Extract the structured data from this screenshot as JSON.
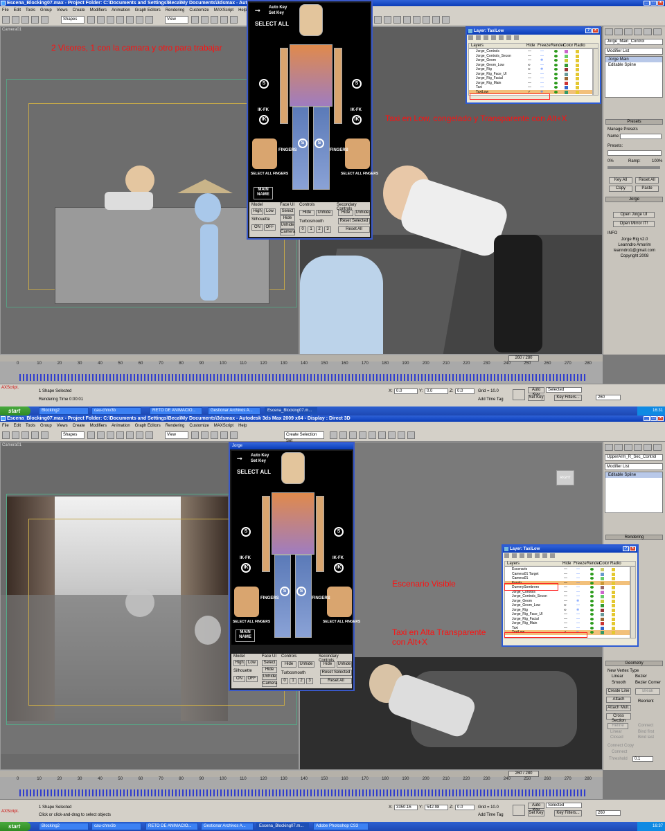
{
  "menu": [
    "File",
    "Edit",
    "Tools",
    "Group",
    "Views",
    "Create",
    "Modifiers",
    "Animation",
    "Graph Editors",
    "Rendering",
    "Customize",
    "MAXScript",
    "Help"
  ],
  "top": {
    "title": "Escena_Blocking07.max   - Project Folder: C:\\Documents and Settings\\Beca\\My Documents\\3dsmax   - Autod",
    "shapes_select": "Shapes",
    "view_select": "View",
    "viewport_label": "Camera01",
    "annotation_1": "2 Visores, 1 con la camara y otro para trabajar",
    "annotation_2": "Taxi en Low, congelado y Transparente con Alt+X",
    "cmd": {
      "object_name": "Jorge_Main_Control",
      "modifier_list": "Modifier List",
      "stack": [
        "Jorge Main",
        "Editable Spline"
      ],
      "presets_rollout": "Presets",
      "manage_presets": "Manage Presets",
      "name_label": "Name:",
      "presets_label": "Presets:",
      "ramp_left": "0%",
      "ramp_mid": "Ramp:",
      "ramp_right": "100%",
      "key_all": "Key All",
      "reset_all": "Reset All",
      "copy": "Copy",
      "paste": "Paste",
      "jorge_rollout": "Jorge",
      "open_ui": "Open Jorge UI",
      "open_mirror": "Open Mirror IT!",
      "info_label": "INFO",
      "info": [
        "Jorge Rig v2.0",
        "Leanndro Amorim",
        "leanndro1@gmail.com",
        "Copyright 2008"
      ]
    },
    "layer_dialog": {
      "title": "Layer: TaxiLow",
      "headers": [
        "Layers",
        "Hide",
        "Freeze",
        "Render",
        "Color",
        "Radio"
      ],
      "rows": [
        {
          "name": "Jorge_Controls",
          "hide": "—",
          "freeze": "—",
          "color": "#cc66cc"
        },
        {
          "name": "Jorge_Controls_Secon",
          "hide": "—",
          "freeze": "—",
          "color": "#66cc66"
        },
        {
          "name": "Jorge_Geom",
          "hide": "—",
          "freeze": "❄",
          "color": "#cccc33"
        },
        {
          "name": "Jorge_Geom_Low",
          "hide": "∞",
          "freeze": "—",
          "color": "#339933"
        },
        {
          "name": "Jorge_Rig",
          "hide": "∞",
          "freeze": "❄",
          "color": "#993333"
        },
        {
          "name": "Jorge_Rig_Face_UI",
          "hide": "—",
          "freeze": "—",
          "color": "#669999"
        },
        {
          "name": "Jorge_Rig_Facial",
          "hide": "—",
          "freeze": "—",
          "color": "#996633"
        },
        {
          "name": "Jorge_Rig_Main",
          "hide": "—",
          "freeze": "—",
          "color": "#cc3333"
        },
        {
          "name": "Taxi",
          "hide": "—",
          "freeze": "—",
          "color": "#3366cc"
        },
        {
          "name": "TaxiLow",
          "hide": "✓",
          "freeze": "❄",
          "color": "#339966"
        }
      ]
    },
    "time": {
      "slider": "260 / 280",
      "ticks": [
        "0",
        "10",
        "20",
        "30",
        "40",
        "50",
        "60",
        "70",
        "80",
        "90",
        "100",
        "110",
        "120",
        "130",
        "140",
        "150",
        "160",
        "170",
        "180",
        "190",
        "200",
        "210",
        "220",
        "230",
        "240",
        "250",
        "260",
        "270",
        "280"
      ]
    },
    "status": {
      "selected": "1 Shape Selected",
      "prompt": "Rendering Time  0:00:01",
      "maxscript": "AXScript.",
      "x_label": "X:",
      "x": "0.0",
      "y_label": "Y:",
      "y": "0.0",
      "z_label": "Z:",
      "z": "0.0",
      "grid": "Grid = 10.0",
      "add_time_tag": "Add Time Tag",
      "auto_key": "Auto Key",
      "set_key": "Set Key",
      "selected_sel": "Selected",
      "key_filters": "Key Filters...",
      "frame": "260"
    },
    "tasks": [
      "Blocking2",
      "cau-chnv3b",
      "RETO DE ANIMACIO...",
      "Gestionar Archivos A...",
      "Escena_Blocking07.m..."
    ],
    "clock": "16:31"
  },
  "bottom": {
    "title": "Escena_Blocking07.max   - Project Folder: C:\\Documents and Settings\\Beca\\My Documents\\3dsmax   - Autodesk 3ds Max  2009 x64     - Display : Direct 3D",
    "shapes_select": "Shapes",
    "view_select": "View",
    "selection_set": "Create Selection Set",
    "viewport_label": "Camera01",
    "viewcube_label": "RIGHT",
    "annotation_1": "Escenario Visible",
    "annotation_2": "Taxi en Alta Transparente\ncon Alt+X",
    "cmd": {
      "object_name": "UpperArm_R_Sec_Control",
      "modifier_list": "Modifier List",
      "stack": [
        "Editable Spline"
      ],
      "rendering_rollout": "Rendering",
      "geometry_rollout": "Geometry",
      "new_vertex_type": "New Vertex Type",
      "linear": "Linear",
      "bezier": "Bezier",
      "smooth": "Smooth",
      "bezier_corner": "Bezier Corner",
      "create_line": "Create Line",
      "break": "Break",
      "attach": "Attach",
      "reorient": "Reorient",
      "attach_mult": "Attach Mult.",
      "cross_section": "Cross Section",
      "refine": "Refine",
      "connect": "Connect",
      "linear2": "Linear",
      "bind_first": "Bind first",
      "closed": "Closed",
      "bind_last": "Bind last",
      "connect_copy": "Connect Copy",
      "connect2": "Connect",
      "threshold_label": "Threshold",
      "threshold": "0.1",
      "end_point_welding": "End Point Auto-Welding",
      "automatic_welding": "Automatic Welding",
      "threshold2": "6.0",
      "weld": "Weld"
    },
    "layer_dialog": {
      "title": "Layer: TaxiLow",
      "headers": [
        "Layers",
        "Hide",
        "Freeze",
        "Render",
        "Color",
        "Radio"
      ],
      "rows": [
        {
          "name": "Escenario",
          "hide": "—",
          "freeze": "—",
          "color": "#cccc66"
        },
        {
          "name": "Camera01 Target",
          "hide": "—",
          "freeze": "—",
          "color": "#6699cc"
        },
        {
          "name": "Camera01",
          "hide": "—",
          "freeze": "—",
          "color": "#66cc66"
        },
        {
          "name": "Fondo",
          "hide": "—",
          "freeze": "—",
          "color": "#cc9933"
        },
        {
          "name": "DummySombrero",
          "hide": "—",
          "freeze": "—",
          "color": "#996666"
        },
        {
          "name": "Jorge_Controls",
          "hide": "—",
          "freeze": "—",
          "color": "#cc66cc"
        },
        {
          "name": "Jorge_Controls_Secon",
          "hide": "—",
          "freeze": "—",
          "color": "#66cc66"
        },
        {
          "name": "Jorge_Geom",
          "hide": "—",
          "freeze": "❄",
          "color": "#cccc33"
        },
        {
          "name": "Jorge_Geom_Low",
          "hide": "∞",
          "freeze": "—",
          "color": "#339933"
        },
        {
          "name": "Jorge_Rig",
          "hide": "∞",
          "freeze": "❄",
          "color": "#993333"
        },
        {
          "name": "Jorge_Rig_Face_UI",
          "hide": "—",
          "freeze": "—",
          "color": "#669999"
        },
        {
          "name": "Jorge_Rig_Facial",
          "hide": "—",
          "freeze": "—",
          "color": "#996633"
        },
        {
          "name": "Jorge_Rig_Main",
          "hide": "—",
          "freeze": "—",
          "color": "#cc3333"
        },
        {
          "name": "Taxi",
          "hide": "—",
          "freeze": "—",
          "color": "#3366cc"
        },
        {
          "name": "TaxiLow",
          "hide": "✓",
          "freeze": "∞",
          "color": "#339966"
        }
      ]
    },
    "time": {
      "slider": "260 / 280",
      "ticks": [
        "0",
        "10",
        "20",
        "30",
        "40",
        "50",
        "60",
        "70",
        "80",
        "90",
        "100",
        "110",
        "120",
        "130",
        "140",
        "150",
        "160",
        "170",
        "180",
        "190",
        "200",
        "210",
        "220",
        "230",
        "240",
        "250",
        "260",
        "270",
        "280"
      ]
    },
    "status": {
      "selected": "1 Shape Selected",
      "prompt": "Click or click-and-drag to select objects",
      "maxscript": "AXScript.",
      "x_label": "X:",
      "x": "3350.16",
      "y_label": "Y:",
      "y": "542.98",
      "z_label": "Z:",
      "z": "0.0",
      "grid": "Grid = 10.0",
      "add_time_tag": "Add Time Tag",
      "auto_key": "Auto Key",
      "set_key": "Set Key",
      "selected_sel": "Selected",
      "key_filters": "Key Filters...",
      "frame": "260"
    },
    "tasks": [
      "Blocking2",
      "cau-chnv3b",
      "RETO DE ANIMACIO...",
      "Gestionar Archivos A...",
      "Escena_Blocking07.m...",
      "Adobe Photoshop CS3"
    ],
    "clock": "16:37"
  },
  "rig": {
    "title": "Jorge",
    "auto_key": "Auto Key",
    "set_key": "Set Key",
    "select_all": "SELECT ALL",
    "s": "S",
    "ikfk": "IK-FK",
    "ik": "IK",
    "fingers": "FINGERS",
    "select_all_fingers": "SELECT ALL FINGERS",
    "main_name": "MAIN\nNAME",
    "model": "Model",
    "high": "High",
    "low": "Low",
    "face_ui": "Face UI",
    "select": "Select",
    "hide": "Hide",
    "unhide": "Unhide",
    "camera": "Camera",
    "controls": "Controls",
    "secondary": "Secondary Controls",
    "reset_selected": "Reset Selected",
    "reset_all": "Reset All",
    "silhouette": "Silhouette",
    "on": "ON",
    "off": "OFF",
    "turbosmooth": "Turbosmooth",
    "ts": [
      "0",
      "1",
      "2",
      "3"
    ]
  },
  "start": "start"
}
